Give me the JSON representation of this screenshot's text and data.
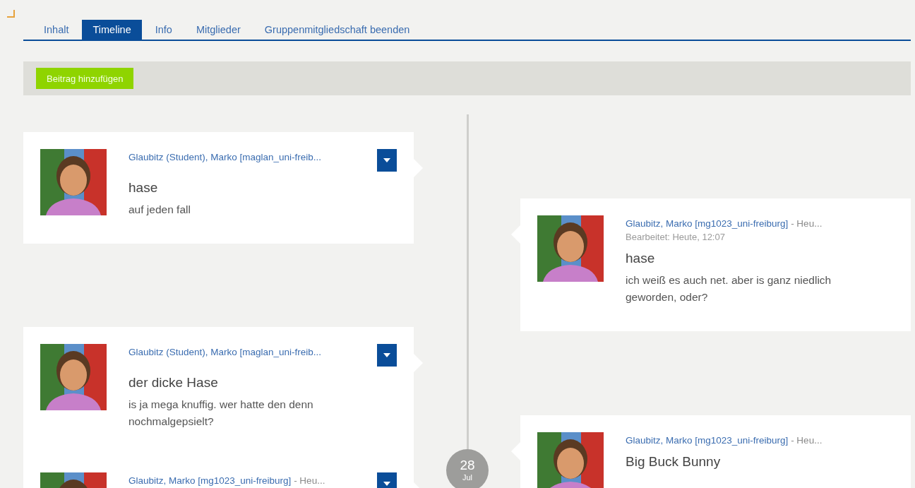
{
  "tabs": [
    {
      "label": "Inhalt",
      "selected": false
    },
    {
      "label": "Timeline",
      "selected": true
    },
    {
      "label": "Info",
      "selected": false
    },
    {
      "label": "Mitglieder",
      "selected": false
    },
    {
      "label": "Gruppenmitgliedschaft beenden",
      "selected": false
    }
  ],
  "toolbar": {
    "add_button": "Beitrag hinzufügen"
  },
  "timeline": {
    "left_column": [
      {
        "author": "Glaubitz (Student), Marko [maglan_uni-freib...",
        "title": "hase",
        "body": "auf jeden fall",
        "menu": true
      },
      {
        "author": "Glaubitz (Student), Marko [maglan_uni-freib...",
        "title": "der dicke Hase",
        "body": "is ja mega knuffig. wer hatte den denn nochmalgepsielt?",
        "menu": true
      },
      {
        "author": "Glaubitz, Marko [mg1023_uni-freiburg]",
        "meta": " - Heu...",
        "menu": true
      }
    ],
    "date": {
      "day": "28",
      "month": "Jul"
    },
    "right_column": [
      {
        "author": "Glaubitz, Marko [mg1023_uni-freiburg]",
        "meta": " - Heu...",
        "edited": "Bearbeitet: Heute, 12:07",
        "title": "hase",
        "body": "ich weiß es auch net. aber is ganz niedlich geworden, oder?",
        "menu": false
      },
      {
        "author": "Glaubitz, Marko [mg1023_uni-freiburg]",
        "meta": " - Heu...",
        "title": "Big Buck Bunny",
        "menu": false
      }
    ]
  }
}
